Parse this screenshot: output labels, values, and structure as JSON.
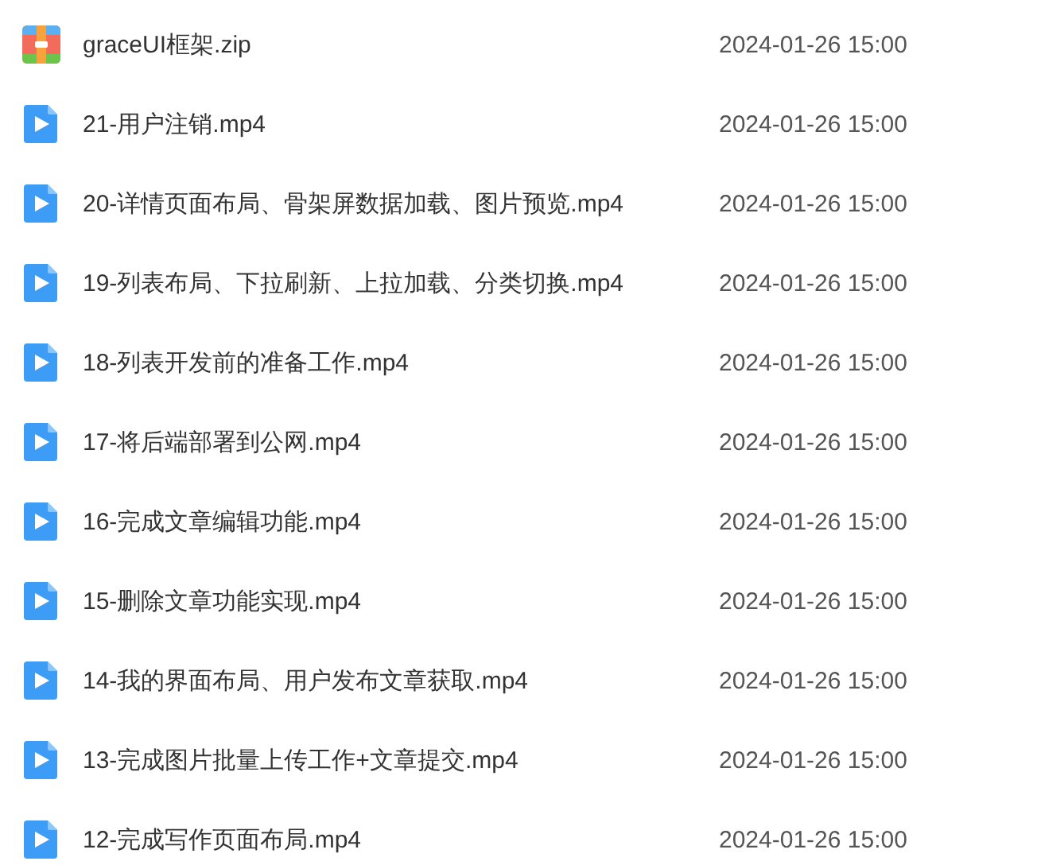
{
  "files": [
    {
      "kind": "zip",
      "name": "graceUI框架.zip",
      "date": "2024-01-26 15:00"
    },
    {
      "kind": "video",
      "name": "21-用户注销.mp4",
      "date": "2024-01-26 15:00"
    },
    {
      "kind": "video",
      "name": "20-详情页面布局、骨架屏数据加载、图片预览.mp4",
      "date": "2024-01-26 15:00"
    },
    {
      "kind": "video",
      "name": "19-列表布局、下拉刷新、上拉加载、分类切换.mp4",
      "date": "2024-01-26 15:00"
    },
    {
      "kind": "video",
      "name": "18-列表开发前的准备工作.mp4",
      "date": "2024-01-26 15:00"
    },
    {
      "kind": "video",
      "name": "17-将后端部署到公网.mp4",
      "date": "2024-01-26 15:00"
    },
    {
      "kind": "video",
      "name": "16-完成文章编辑功能.mp4",
      "date": "2024-01-26 15:00"
    },
    {
      "kind": "video",
      "name": "15-删除文章功能实现.mp4",
      "date": "2024-01-26 15:00"
    },
    {
      "kind": "video",
      "name": "14-我的界面布局、用户发布文章获取.mp4",
      "date": "2024-01-26 15:00"
    },
    {
      "kind": "video",
      "name": "13-完成图片批量上传工作+文章提交.mp4",
      "date": "2024-01-26 15:00"
    },
    {
      "kind": "video",
      "name": "12-完成写作页面布局.mp4",
      "date": "2024-01-26 15:00"
    }
  ]
}
